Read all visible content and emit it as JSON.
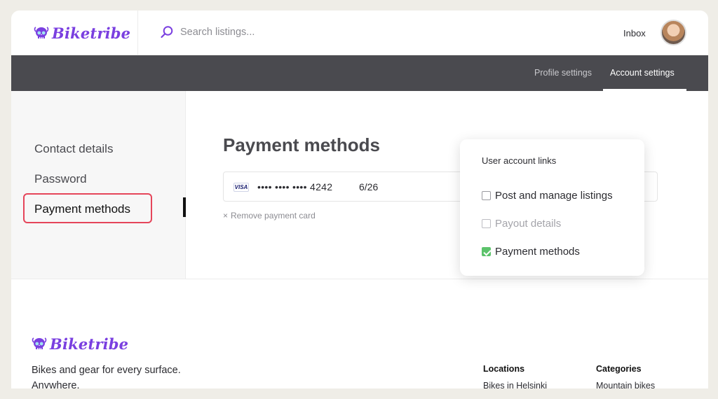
{
  "header": {
    "logo_text": "Biketribe",
    "search_placeholder": "Search listings...",
    "inbox_label": "Inbox"
  },
  "tabs": [
    {
      "label": "Profile settings",
      "active": false
    },
    {
      "label": "Account settings",
      "active": true
    }
  ],
  "sidenav": {
    "items": [
      {
        "label": "Contact details"
      },
      {
        "label": "Password"
      },
      {
        "label": "Payment methods",
        "active": true
      }
    ]
  },
  "main": {
    "title": "Payment methods",
    "card": {
      "brand": "VISA",
      "number_masked": "•••• •••• •••• 4242",
      "expiry": "6/26"
    },
    "remove_label": "Remove payment card"
  },
  "popover": {
    "title": "User account links",
    "items": [
      {
        "label": "Post and manage listings",
        "checked": false,
        "disabled": false
      },
      {
        "label": "Payout details",
        "checked": false,
        "disabled": true
      },
      {
        "label": "Payment methods",
        "checked": true,
        "disabled": false
      }
    ]
  },
  "footer": {
    "logo_text": "Biketribe",
    "tagline": "Bikes and gear for every surface. Anywhere.",
    "columns": [
      {
        "heading": "Locations",
        "links": [
          "Bikes in Helsinki"
        ]
      },
      {
        "heading": "Categories",
        "links": [
          "Mountain bikes"
        ]
      }
    ]
  },
  "colors": {
    "brand": "#7a3fe0",
    "tabbar": "#4a4a4f",
    "highlight": "#e5455a",
    "check": "#5cc36b"
  }
}
